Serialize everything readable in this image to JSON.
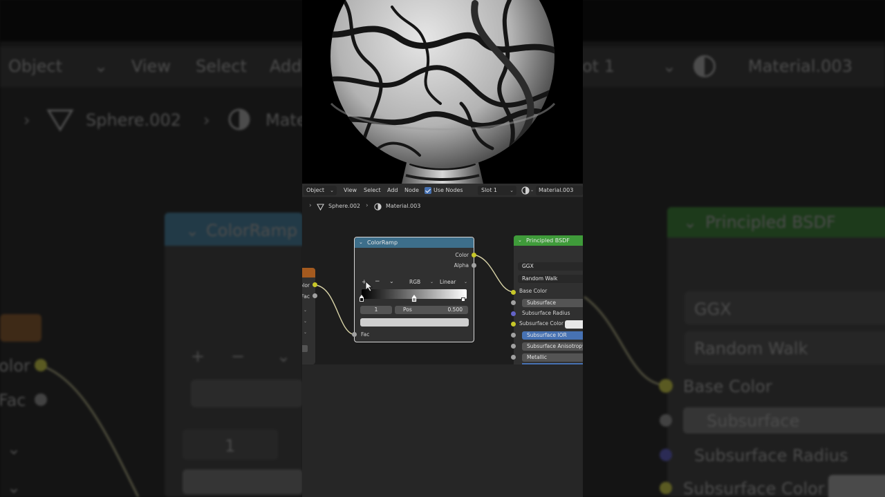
{
  "colors": {
    "colorramp_header": "#3d6e8a",
    "bsdf_header": "#3f9b3a",
    "socket_color": "#c7c729",
    "socket_gray": "#a1a1a1",
    "socket_purple": "#6363c7",
    "accent_blue": "#4772b3"
  },
  "header": {
    "object_mode": "Object",
    "menus": [
      "View",
      "Select",
      "Add",
      "Node"
    ],
    "use_nodes_label": "Use Nodes",
    "slot": "Slot 1",
    "material": "Material.003"
  },
  "breadcrumb": {
    "object": "Sphere.002",
    "material": "Material.003"
  },
  "colorramp": {
    "title": "ColorRamp",
    "out_color": "Color",
    "out_alpha": "Alpha",
    "add_glyph": "+",
    "remove_glyph": "−",
    "more_glyph": "⌄",
    "color_mode": "RGB",
    "interpolation": "Linear",
    "stop_index": "1",
    "pos_label": "Pos",
    "pos_value": "0.500",
    "in_fac": "Fac"
  },
  "left_node": {
    "out_color_partial": "olor",
    "out_fac_partial": "Fac"
  },
  "bsdf": {
    "title": "Principled BSDF",
    "distribution": "GGX",
    "subsurface_method": "Random Walk",
    "inputs": {
      "base_color": "Base Color",
      "subsurface": "Subsurface",
      "subsurface_radius": "Subsurface Radius",
      "subsurface_color": "Subsurface Color",
      "subsurface_ior": "Subsurface IOR",
      "subsurface_anisotropy": "Subsurface Anisotropy",
      "metallic": "Metallic"
    }
  },
  "background": {
    "object_mode": "Object",
    "view": "View",
    "select": "Select",
    "add_partial": "Add",
    "slot_partial": "ot 1",
    "material": "Material.003",
    "object_name": "Sphere.002",
    "material_partial": "Mate",
    "colorramp_title": "ColorRamp",
    "bsdf_title": "Principled BSDF",
    "ggx": "GGX",
    "random_walk": "Random Walk",
    "base_color": "Base Color",
    "subsurface": "Subsurface",
    "subsurface_radius": "Subsurface Radius",
    "subsurface_color": "Subsurface Color",
    "out_color_partial": "olor",
    "out_fac": "Fac",
    "stop_index": "1",
    "add_glyph": "+",
    "remove_glyph": "−"
  }
}
